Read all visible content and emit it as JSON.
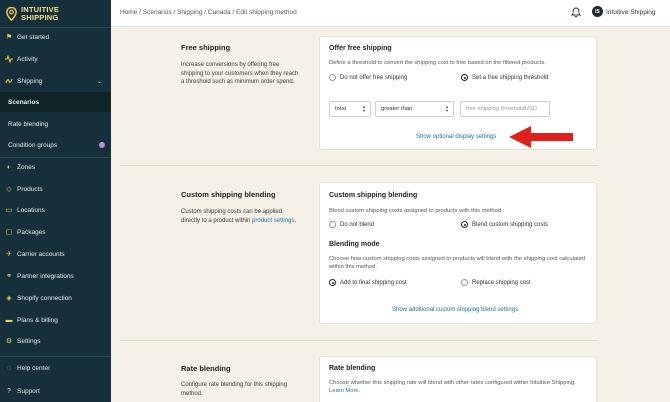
{
  "app": {
    "name_line1": "INTUITIVE",
    "name_line2": "SHIPPING"
  },
  "breadcrumb": "Home / Scenarios / Shipping / Canada / Edit shipping method",
  "user": {
    "initials": "IS",
    "name": "Intuitive Shipping"
  },
  "sidebar": {
    "items": [
      {
        "label": "Get started",
        "icon": "flag-icon"
      },
      {
        "label": "Activity",
        "icon": "activity-icon"
      },
      {
        "label": "Shipping",
        "icon": "shipping-icon"
      },
      {
        "label": "Scenarios"
      },
      {
        "label": "Rate blending"
      },
      {
        "label": "Condition groups",
        "badge": "!"
      },
      {
        "label": "Zones",
        "icon": "zones-icon"
      },
      {
        "label": "Products",
        "icon": "products-icon"
      },
      {
        "label": "Locations",
        "icon": "locations-icon"
      },
      {
        "label": "Packages",
        "icon": "packages-icon"
      },
      {
        "label": "Carrier accounts",
        "icon": "carrier-icon"
      },
      {
        "label": "Partner integrations",
        "icon": "partner-icon"
      },
      {
        "label": "Shopify connection",
        "icon": "shopify-icon"
      },
      {
        "label": "Plans & billing",
        "icon": "billing-icon"
      },
      {
        "label": "Settings",
        "icon": "settings-icon"
      },
      {
        "label": "Help center",
        "icon": "help-icon"
      },
      {
        "label": "Support",
        "icon": "support-icon"
      }
    ]
  },
  "free_shipping": {
    "title": "Free shipping",
    "description": "Increase conversions by offering free shipping to your customers when they reach a threshold such as minimum order spend.",
    "card_title": "Offer free shipping",
    "card_sub": "Define a threshold to convert the shipping cost to free based on the filtered products.",
    "option_off": "Do not offer free shipping",
    "option_on": "Set a free shipping threshold",
    "selected": "Set a free shipping threshold",
    "field_select": "total",
    "operator_select": "greater than",
    "threshold_placeholder": "free shipping threshold",
    "currency": "USD",
    "optional_link": "Show optional display settings"
  },
  "blending": {
    "title": "Custom shipping blending",
    "description_prefix": "Custom shipping costs can be applied directly to a product within ",
    "description_link": "product settings",
    "description_suffix": ".",
    "card_title": "Custom shipping blending",
    "card_sub": "Blend custom shipping costs assigned to products with this method.",
    "option_off": "Do not blend",
    "option_on": "Blend custom shipping costs",
    "selected": "Blend custom shipping costs",
    "mode_title": "Blending mode",
    "mode_sub": "Choose how custom shipping costs assigned to products will blend with the shipping cost calculated within this method.",
    "mode_add": "Add to final shipping cost",
    "mode_replace": "Replace shipping cost",
    "mode_selected": "Add to final shipping cost",
    "additional_link": "Show additional custom shipping blend settings"
  },
  "rate_blending": {
    "title": "Rate blending",
    "description": "Configure rate blending for this shipping method.",
    "card_title": "Rate blending",
    "card_sub": "Choose whether this shipping rate will blend with other rates configured within Intuitive Shipping.",
    "learn_more": "Learn More."
  },
  "colors": {
    "sidebar": "#15303a",
    "accent": "#f0d34a",
    "link": "#1d6fa8",
    "arrow": "#e0201a",
    "page": "#f6f1e6"
  }
}
